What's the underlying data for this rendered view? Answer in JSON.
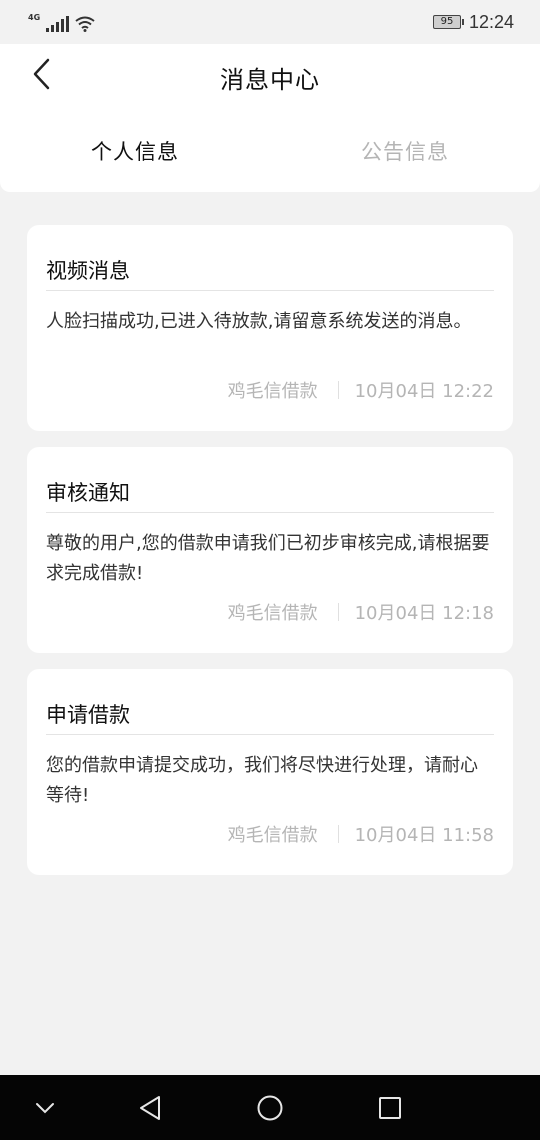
{
  "status": {
    "network": "4G",
    "battery": "95",
    "time": "12:24"
  },
  "header": {
    "title": "消息中心",
    "back_icon": "chevron-left-icon"
  },
  "tabs": [
    {
      "label": "个人信息",
      "active": true
    },
    {
      "label": "公告信息",
      "active": false
    }
  ],
  "messages": [
    {
      "title": "视频消息",
      "body": "人脸扫描成功,已进入待放款,请留意系统发送的消息。",
      "source": "鸡毛信借款",
      "time": "10月04日 12:22"
    },
    {
      "title": "审核通知",
      "body": "尊敬的用户,您的借款申请我们已初步审核完成,请根据要求完成借款!",
      "source": "鸡毛信借款",
      "time": "10月04日 12:18"
    },
    {
      "title": "申请借款",
      "body": "您的借款申请提交成功，我们将尽快进行处理，请耐心等待!",
      "source": "鸡毛信借款",
      "time": "10月04日 11:58"
    }
  ],
  "system_nav": {
    "icons": [
      "chevron-down-icon",
      "back-triangle-icon",
      "home-circle-icon",
      "recents-square-icon"
    ]
  }
}
